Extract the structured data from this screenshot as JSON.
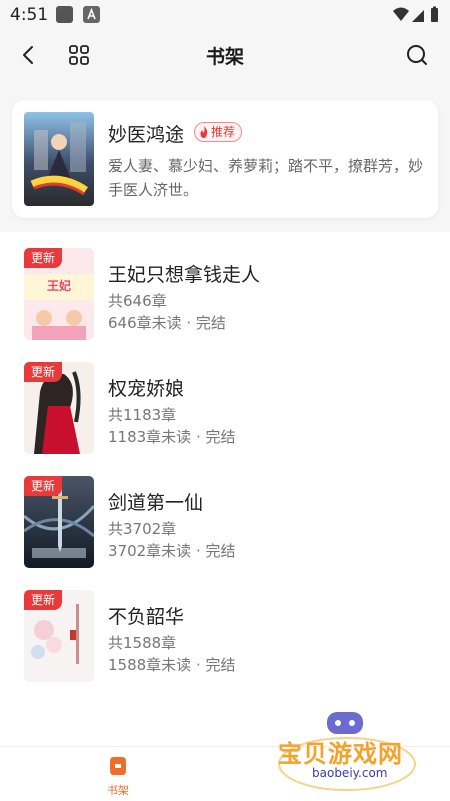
{
  "status_bar": {
    "time": "4:51"
  },
  "header": {
    "title": "书架",
    "back_icon": "back-arrow-icon",
    "grid_icon": "grid-icon",
    "search_icon": "search-icon"
  },
  "recommended": {
    "title": "妙医鸿途",
    "badge": "推荐",
    "badge_icon": "flame-icon",
    "description": "爱人妻、慕少妇、养萝莉；踏不平，撩群芳，妙手医人济世。"
  },
  "books": [
    {
      "tag": "更新",
      "title": "王妃只想拿钱走人",
      "count": "共646章",
      "status": "646章未读 · 完结"
    },
    {
      "tag": "更新",
      "title": "权宠娇娘",
      "count": "共1183章",
      "status": "1183章未读 · 完结"
    },
    {
      "tag": "更新",
      "title": "剑道第一仙",
      "count": "共3702章",
      "status": "3702章未读 · 完结"
    },
    {
      "tag": "更新",
      "title": "不负韶华",
      "count": "共1588章",
      "status": "1588章未读 · 完结"
    }
  ],
  "tabbar": {
    "shelf_label": "书架"
  },
  "watermark": {
    "text": "宝贝游戏网",
    "url": "baobeiy.com"
  },
  "colors": {
    "accent": "#f06c2a",
    "badge_red": "#e83a3a"
  }
}
